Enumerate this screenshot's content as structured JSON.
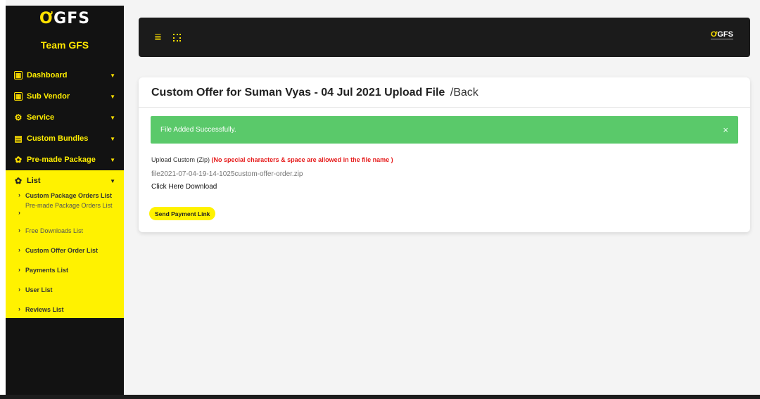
{
  "brand": {
    "logo_text": "GFS",
    "team_name": "Team GFS"
  },
  "sidebar": {
    "items": [
      {
        "label": "Dashboard"
      },
      {
        "label": "Sub Vendor"
      },
      {
        "label": "Service"
      },
      {
        "label": "Custom Bundles"
      },
      {
        "label": "Pre-made Package"
      }
    ],
    "list": {
      "label": "List",
      "children": [
        "Custom Package Orders List",
        "Pre-made Package Orders List",
        "Free Downloads List",
        "Custom Offer Order List",
        "Payments List",
        "User List",
        "Reviews List"
      ]
    }
  },
  "topbar": {
    "logo_text": "GFS"
  },
  "main": {
    "title": "Custom Offer for Suman Vyas - 04 Jul 2021 Upload File",
    "back_link": "/Back",
    "alert": {
      "message": "File Added Successfully.",
      "close_symbol": "×"
    },
    "upload_label": "Upload Custom (Zip)",
    "upload_warning": "(No special characters & space are allowed in the file name )",
    "file_name": "file2021-07-04-19-14-1025custom-offer-order.zip",
    "download_link": "Click Here Download",
    "send_button": "Send Payment Link"
  },
  "colors": {
    "accent": "#fff200",
    "sidebar_bg": "#121212",
    "success": "#5ac96a",
    "warning": "#e61b1b"
  }
}
